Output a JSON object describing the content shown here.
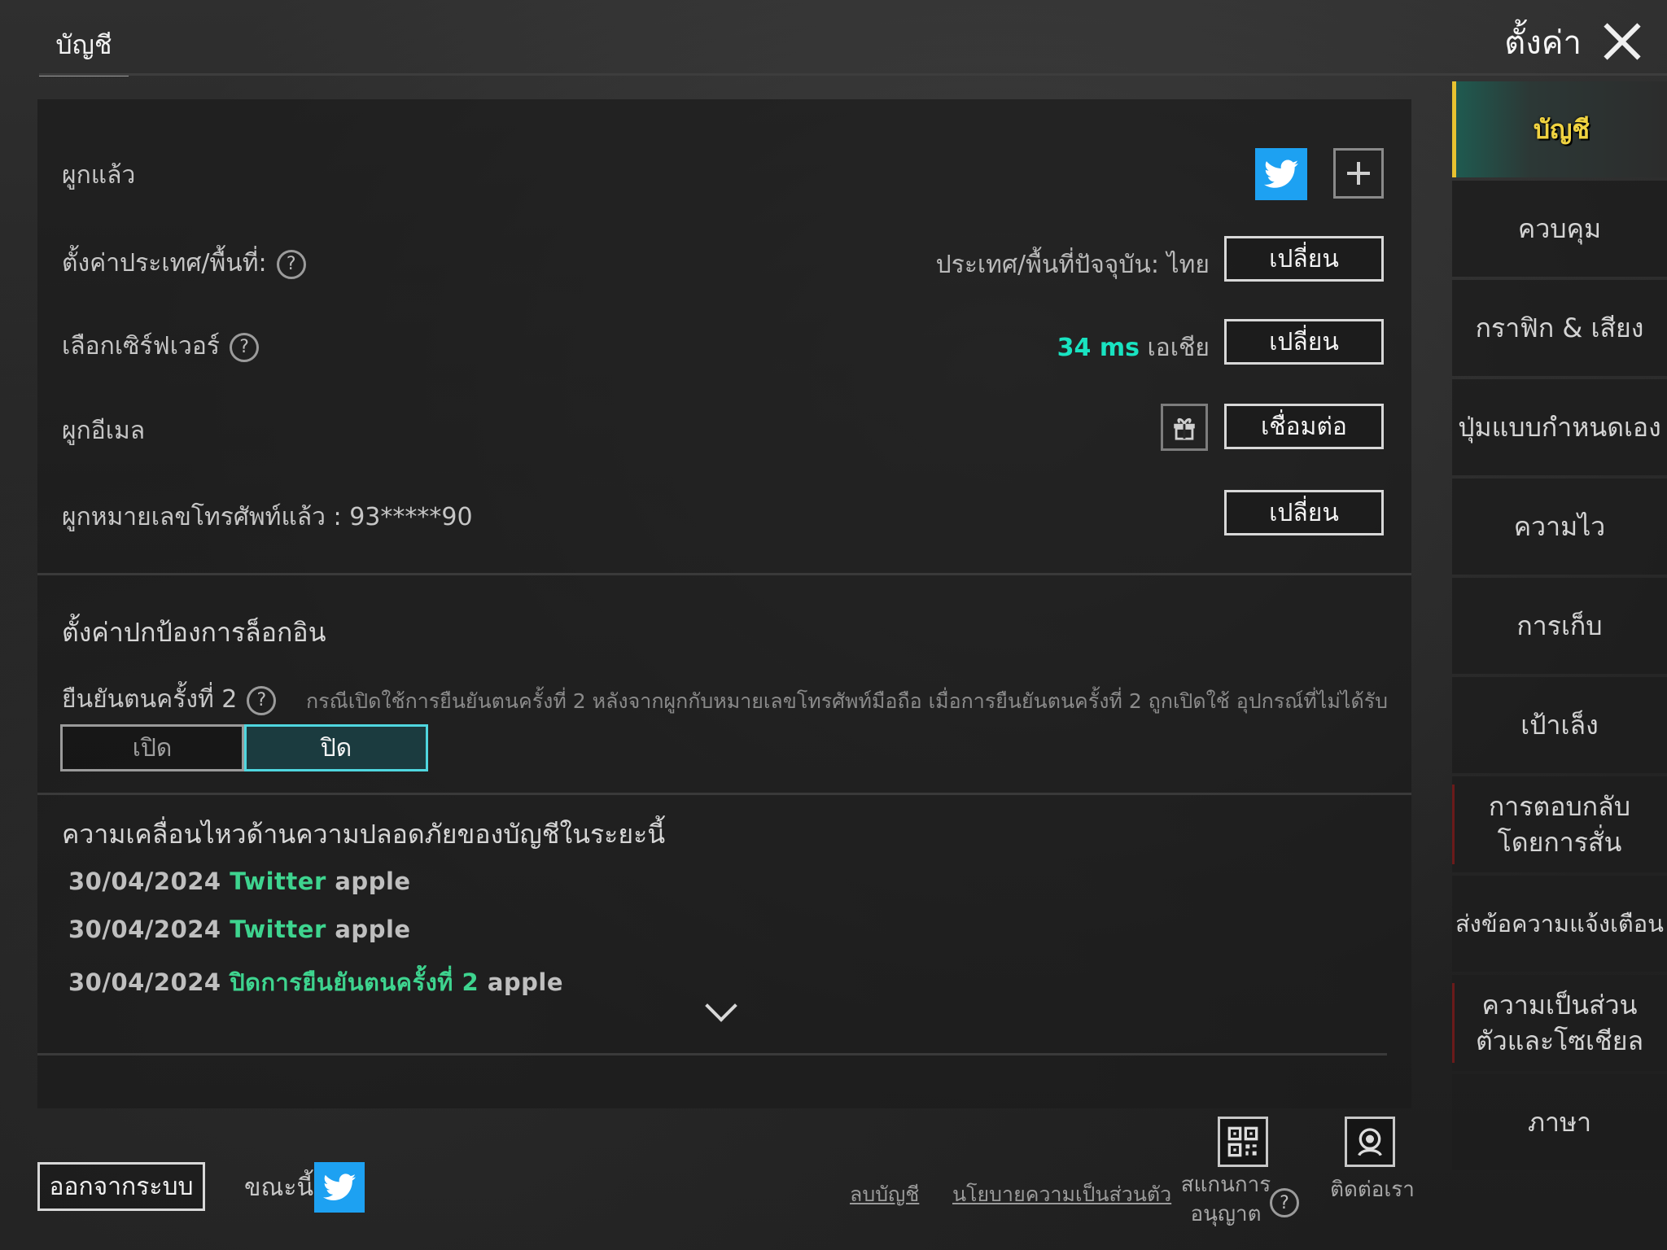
{
  "header": {
    "tab_label": "บัญชี",
    "title": "ตั้งค่า"
  },
  "account": {
    "bound_label": "ผูกแล้ว",
    "region_label": "ตั้งค่าประเทศ/พื้นที่:",
    "region_value": "ประเทศ/พื้นที่ปัจจุบัน: ไทย",
    "region_button": "เปลี่ยน",
    "server_label": "เลือกเซิร์ฟเวอร์",
    "server_ping": "34 ms",
    "server_region": "เอเชีย",
    "server_button": "เปลี่ยน",
    "email_label": "ผูกอีเมล",
    "email_button": "เชื่อมต่อ",
    "phone_label": "ผูกหมายเลขโทรศัพท์แล้ว : 93*****90",
    "phone_button": "เปลี่ยน"
  },
  "login_protection": {
    "title": "ตั้งค่าปกป้องการล็อกอิน",
    "two_step_label": "ยืนยันตนครั้งที่ 2",
    "two_step_desc": "กรณีเปิดใช้การยืนยันตนครั้งที่ 2 หลังจากผูกกับหมายเลขโทรศัพท์มือถือ เมื่อการยืนยันตนครั้งที่ 2 ถูกเปิดใช้ อุปกรณ์ที่ไม่ได้รับการเ",
    "toggle_on_label": "เปิด",
    "toggle_off_label": "ปิด",
    "selected": "ปิด"
  },
  "security_activity": {
    "title": "ความเคลื่อนไหวด้านความปลอดภัยของบัญชีในระยะนี้",
    "rows": [
      {
        "date": "30/04/2024",
        "source": "Twitter",
        "name": "apple"
      },
      {
        "date": "30/04/2024",
        "source": "Twitter",
        "name": "apple"
      },
      {
        "date": "30/04/2024",
        "source": "ปิดการยืนยันตนครั้งที่ 2",
        "name": "apple"
      }
    ]
  },
  "sidebar": {
    "items": [
      {
        "label": "บัญชี",
        "active": true
      },
      {
        "label": "ควบคุม"
      },
      {
        "label": "กราฟิก & เสียง"
      },
      {
        "label": "ปุ่มแบบกำหนดเอง"
      },
      {
        "label": "ความไว"
      },
      {
        "label": "การเก็บ"
      },
      {
        "label": "เป้าเล็ง"
      },
      {
        "label": "การตอบกลับโดยการสั่น"
      },
      {
        "label": "ส่งข้อความแจ้งเตือน"
      },
      {
        "label": "ความเป็นส่วนตัวและโซเชียล"
      },
      {
        "label": "ภาษา"
      }
    ]
  },
  "footer": {
    "logout": "ออกจากระบบ",
    "now_label": "ขณะนี้",
    "delete_account": "ลบบัญชี",
    "privacy_policy": "นโยบายความเป็นส่วนตัว",
    "scan_license": "สแกนการอนุญาต",
    "contact_us": "ติดต่อเรา"
  },
  "colors": {
    "accent_teal": "#19e3c1",
    "activity_green": "#3ed48f",
    "twitter_blue": "#1da1f2",
    "active_tab_yellow": "#f0d341"
  }
}
